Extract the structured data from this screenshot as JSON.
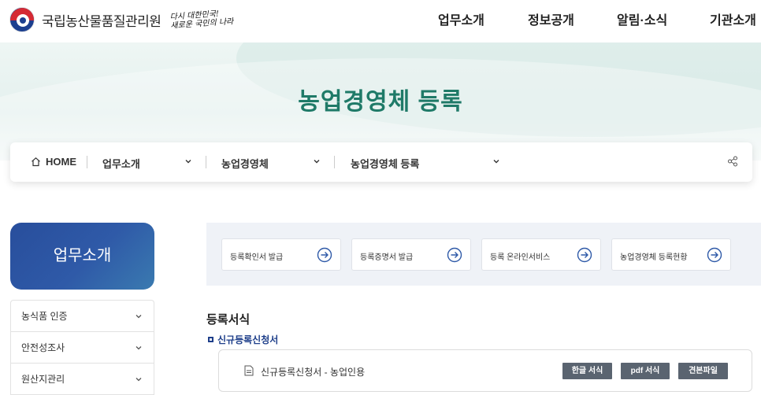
{
  "header": {
    "org_name": "국립농산물품질관리원",
    "slogan_line1": "다시 대한민국!",
    "slogan_line2": "새로운 국민의 나라",
    "nav": [
      "업무소개",
      "정보공개",
      "알림·소식",
      "기관소개"
    ]
  },
  "hero": {
    "title": "농업경영체 등록"
  },
  "breadcrumb": {
    "home": "HOME",
    "level1": "업무소개",
    "level2": "농업경영체",
    "level3": "농업경영체 등록"
  },
  "sidebar": {
    "title": "업무소개",
    "items": [
      "농식품 인증",
      "안전성조사",
      "원산지관리"
    ]
  },
  "quick_links": [
    "등록확인서 발급",
    "등록증명서 발급",
    "등록 온라인서비스",
    "농업경영체 등록현황"
  ],
  "forms": {
    "section_title": "등록서식",
    "subsection_title": "신규등록신청서",
    "rows": [
      {
        "name": "신규등록신청서 - 농업인용",
        "buttons": [
          "한글 서식",
          "pdf 서식",
          "견본파일"
        ]
      }
    ]
  },
  "colors": {
    "brand_blue": "#2f5aa8",
    "hero_title_green": "#1f7a68",
    "download_button": "#5a6470",
    "subsection_blue": "#1e3f8a"
  }
}
